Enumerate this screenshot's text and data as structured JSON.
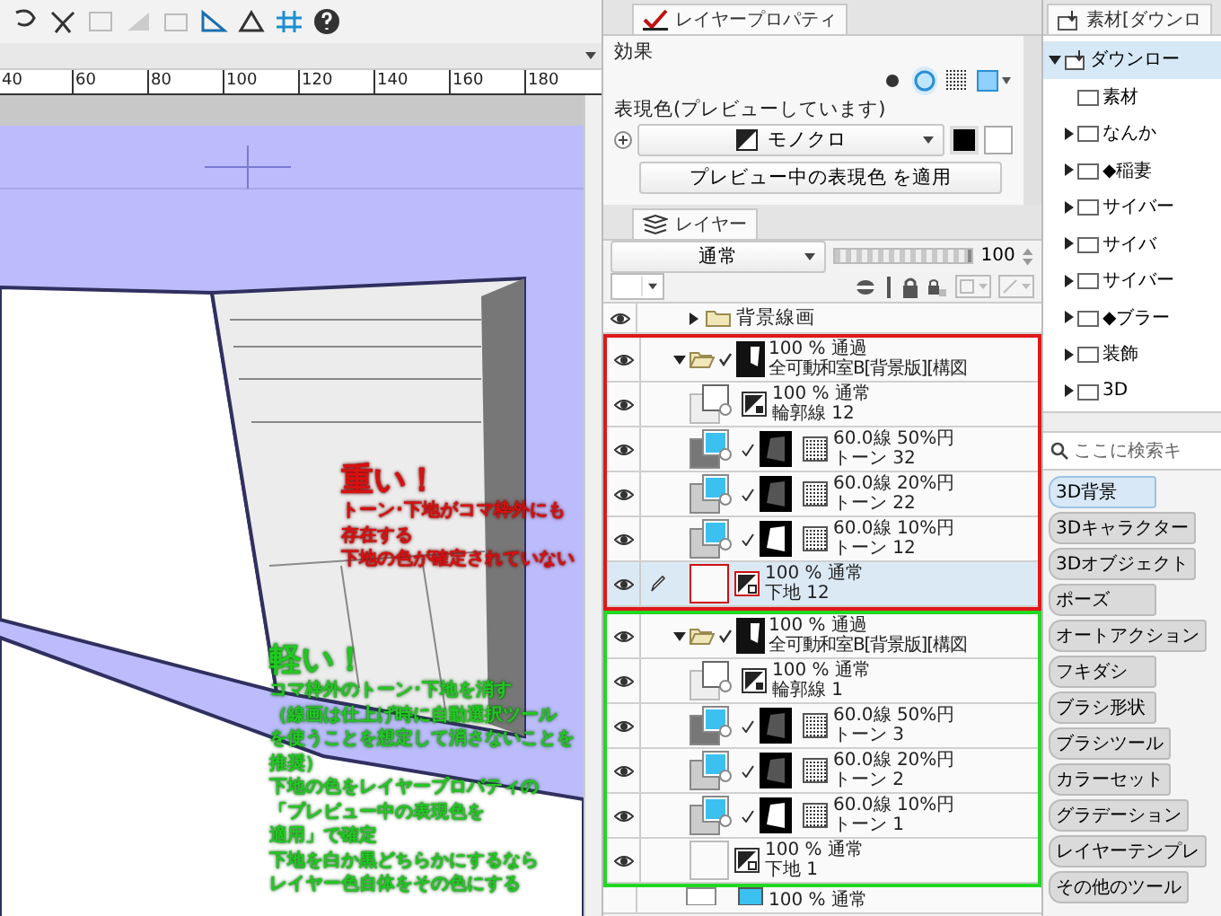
{
  "canvas": {
    "ruler_ticks": [
      "40",
      "60",
      "80",
      "100",
      "120",
      "140",
      "160",
      "180"
    ],
    "notes": [
      {
        "kind": "heavy",
        "color": "#d81010",
        "heading": "重い！",
        "lines": [
          "トーン･下地がコマ枠外にも",
          "存在する",
          "下地の色が確定されていない"
        ]
      },
      {
        "kind": "light",
        "color": "#22c822",
        "heading": "軽い！",
        "lines": [
          "コマ枠外のトーン･下地を消す",
          "（線画は仕上げ時に自動選択ツール",
          "を使うことを想定して消さないことを",
          "推奨）",
          "下地の色をレイヤープロパティの",
          "「プレビュー中の表現色を",
          "適用」で確定",
          "下地を白か黒どちらかにするなら",
          "レイヤー色自体をその色にする"
        ]
      }
    ]
  },
  "layer_property": {
    "tab": "レイヤープロパティ",
    "effect_label": "効果",
    "effects": [
      {
        "kind": "dot",
        "selected": false
      },
      {
        "kind": "circle",
        "selected": true
      },
      {
        "kind": "tone",
        "selected": false
      },
      {
        "kind": "color",
        "selected": false
      }
    ],
    "expression_label": "表現色(プレビューしています)",
    "expression_value": "モノクロ",
    "apply_button": "プレビュー中の表現色 を適用"
  },
  "layer_panel": {
    "tab": "レイヤー",
    "blend_mode": "通常",
    "opacity": {
      "level": 1.0,
      "reading": "100"
    },
    "layers": [
      {
        "kind": "folder",
        "name": "背景線画",
        "expanded": false,
        "visible": true,
        "selected": false
      },
      {
        "kind": "folder",
        "mode": "100 % 通過",
        "name": "全可動和室B[背景版][構図",
        "expanded": true,
        "visible": true,
        "selected": false,
        "color": "#e01818",
        "children": [
          {
            "kind": "line",
            "mode": "100 % 通常",
            "name": "輪郭線 12",
            "visible": true,
            "selected": false
          },
          {
            "kind": "tone",
            "mode": "60.0線 50%円",
            "name": "トーン 32",
            "visible": true,
            "selected": false
          },
          {
            "kind": "tone",
            "mode": "60.0線 20%円",
            "name": "トーン 22",
            "visible": true,
            "selected": false
          },
          {
            "kind": "tone",
            "mode": "60.0線 10%円",
            "name": "トーン 12",
            "visible": true,
            "selected": false
          },
          {
            "kind": "base",
            "mode": "100 % 通常",
            "name": "下地 12",
            "visible": true,
            "selected": true
          }
        ]
      },
      {
        "kind": "folder",
        "mode": "100 % 通過",
        "name": "全可動和室B[背景版][構図",
        "expanded": true,
        "visible": true,
        "selected": false,
        "color": "#22d822",
        "children": [
          {
            "kind": "line",
            "mode": "100 % 通常",
            "name": "輪郭線 1",
            "visible": true,
            "selected": false
          },
          {
            "kind": "tone",
            "mode": "60.0線 50%円",
            "name": "トーン 3",
            "visible": true,
            "selected": false
          },
          {
            "kind": "tone",
            "mode": "60.0線 20%円",
            "name": "トーン 2",
            "visible": true,
            "selected": false
          },
          {
            "kind": "tone",
            "mode": "60.0線 10%円",
            "name": "トーン 1",
            "visible": true,
            "selected": false
          },
          {
            "kind": "base",
            "mode": "100 % 通常",
            "name": "下地 1",
            "visible": true,
            "selected": false
          }
        ]
      },
      {
        "kind": "partial",
        "mode": "100 % 通常"
      }
    ]
  },
  "material_panel": {
    "tab": "素材[ダウンロ",
    "tree": [
      {
        "label": "ダウンロー",
        "expanded": true,
        "selected": true,
        "children": [
          {
            "label": "素材",
            "expandable": false
          },
          {
            "label": "なんか",
            "expandable": true
          },
          {
            "label": "◆稲妻",
            "expandable": true
          },
          {
            "label": "サイバー",
            "expandable": true
          },
          {
            "label": "サイバ",
            "expandable": true
          },
          {
            "label": "サイバー",
            "expandable": true
          },
          {
            "label": "◆ブラー",
            "expandable": true
          },
          {
            "label": "装飾",
            "expandable": true
          },
          {
            "label": "3D",
            "expandable": true
          }
        ]
      }
    ],
    "search": {
      "placeholder": "ここに検索キ"
    },
    "tags": [
      {
        "label": "3D背景",
        "selected": true
      },
      {
        "label": "3Dキャラクター",
        "selected": false
      },
      {
        "label": "3Dオブジェクト",
        "selected": false
      },
      {
        "label": "ポーズ",
        "selected": false
      },
      {
        "label": "オートアクション",
        "selected": false
      },
      {
        "label": "フキダシ",
        "selected": false
      },
      {
        "label": "ブラシ形状",
        "selected": false
      },
      {
        "label": "ブラシツール",
        "selected": false
      },
      {
        "label": "カラーセット",
        "selected": false
      },
      {
        "label": "グラデーション",
        "selected": false
      },
      {
        "label": "レイヤーテンプレ",
        "selected": false
      },
      {
        "label": "その他のツール",
        "selected": false
      }
    ]
  }
}
